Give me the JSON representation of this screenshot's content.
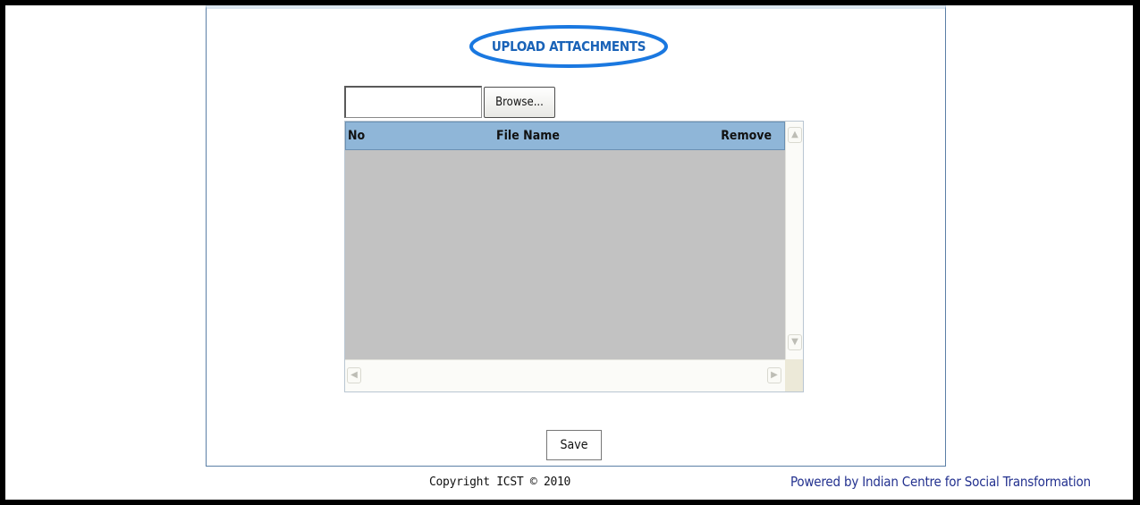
{
  "page": {
    "title": "UPLOAD ATTACHMENTS"
  },
  "upload": {
    "file_value": "",
    "browse_label": "Browse..."
  },
  "grid": {
    "columns": [
      "No",
      "File Name",
      "Remove"
    ],
    "rows": []
  },
  "actions": {
    "save_label": "Save"
  },
  "footer": {
    "copyright": "Copyright ICST © 2010",
    "powered_by": "Powered by Indian Centre for Social Transformation"
  },
  "icons": {
    "scroll_up": "scroll-up-icon",
    "scroll_down": "scroll-down-icon",
    "scroll_left": "scroll-left-icon",
    "scroll_right": "scroll-right-icon"
  },
  "colors": {
    "title": "#1a63b8",
    "title_ellipse": "#1a78e0",
    "grid_header": "#8fb6d8",
    "grid_body": "#c2c2c2",
    "panel_border": "#5b7fa6",
    "powered_by": "#23318f"
  }
}
